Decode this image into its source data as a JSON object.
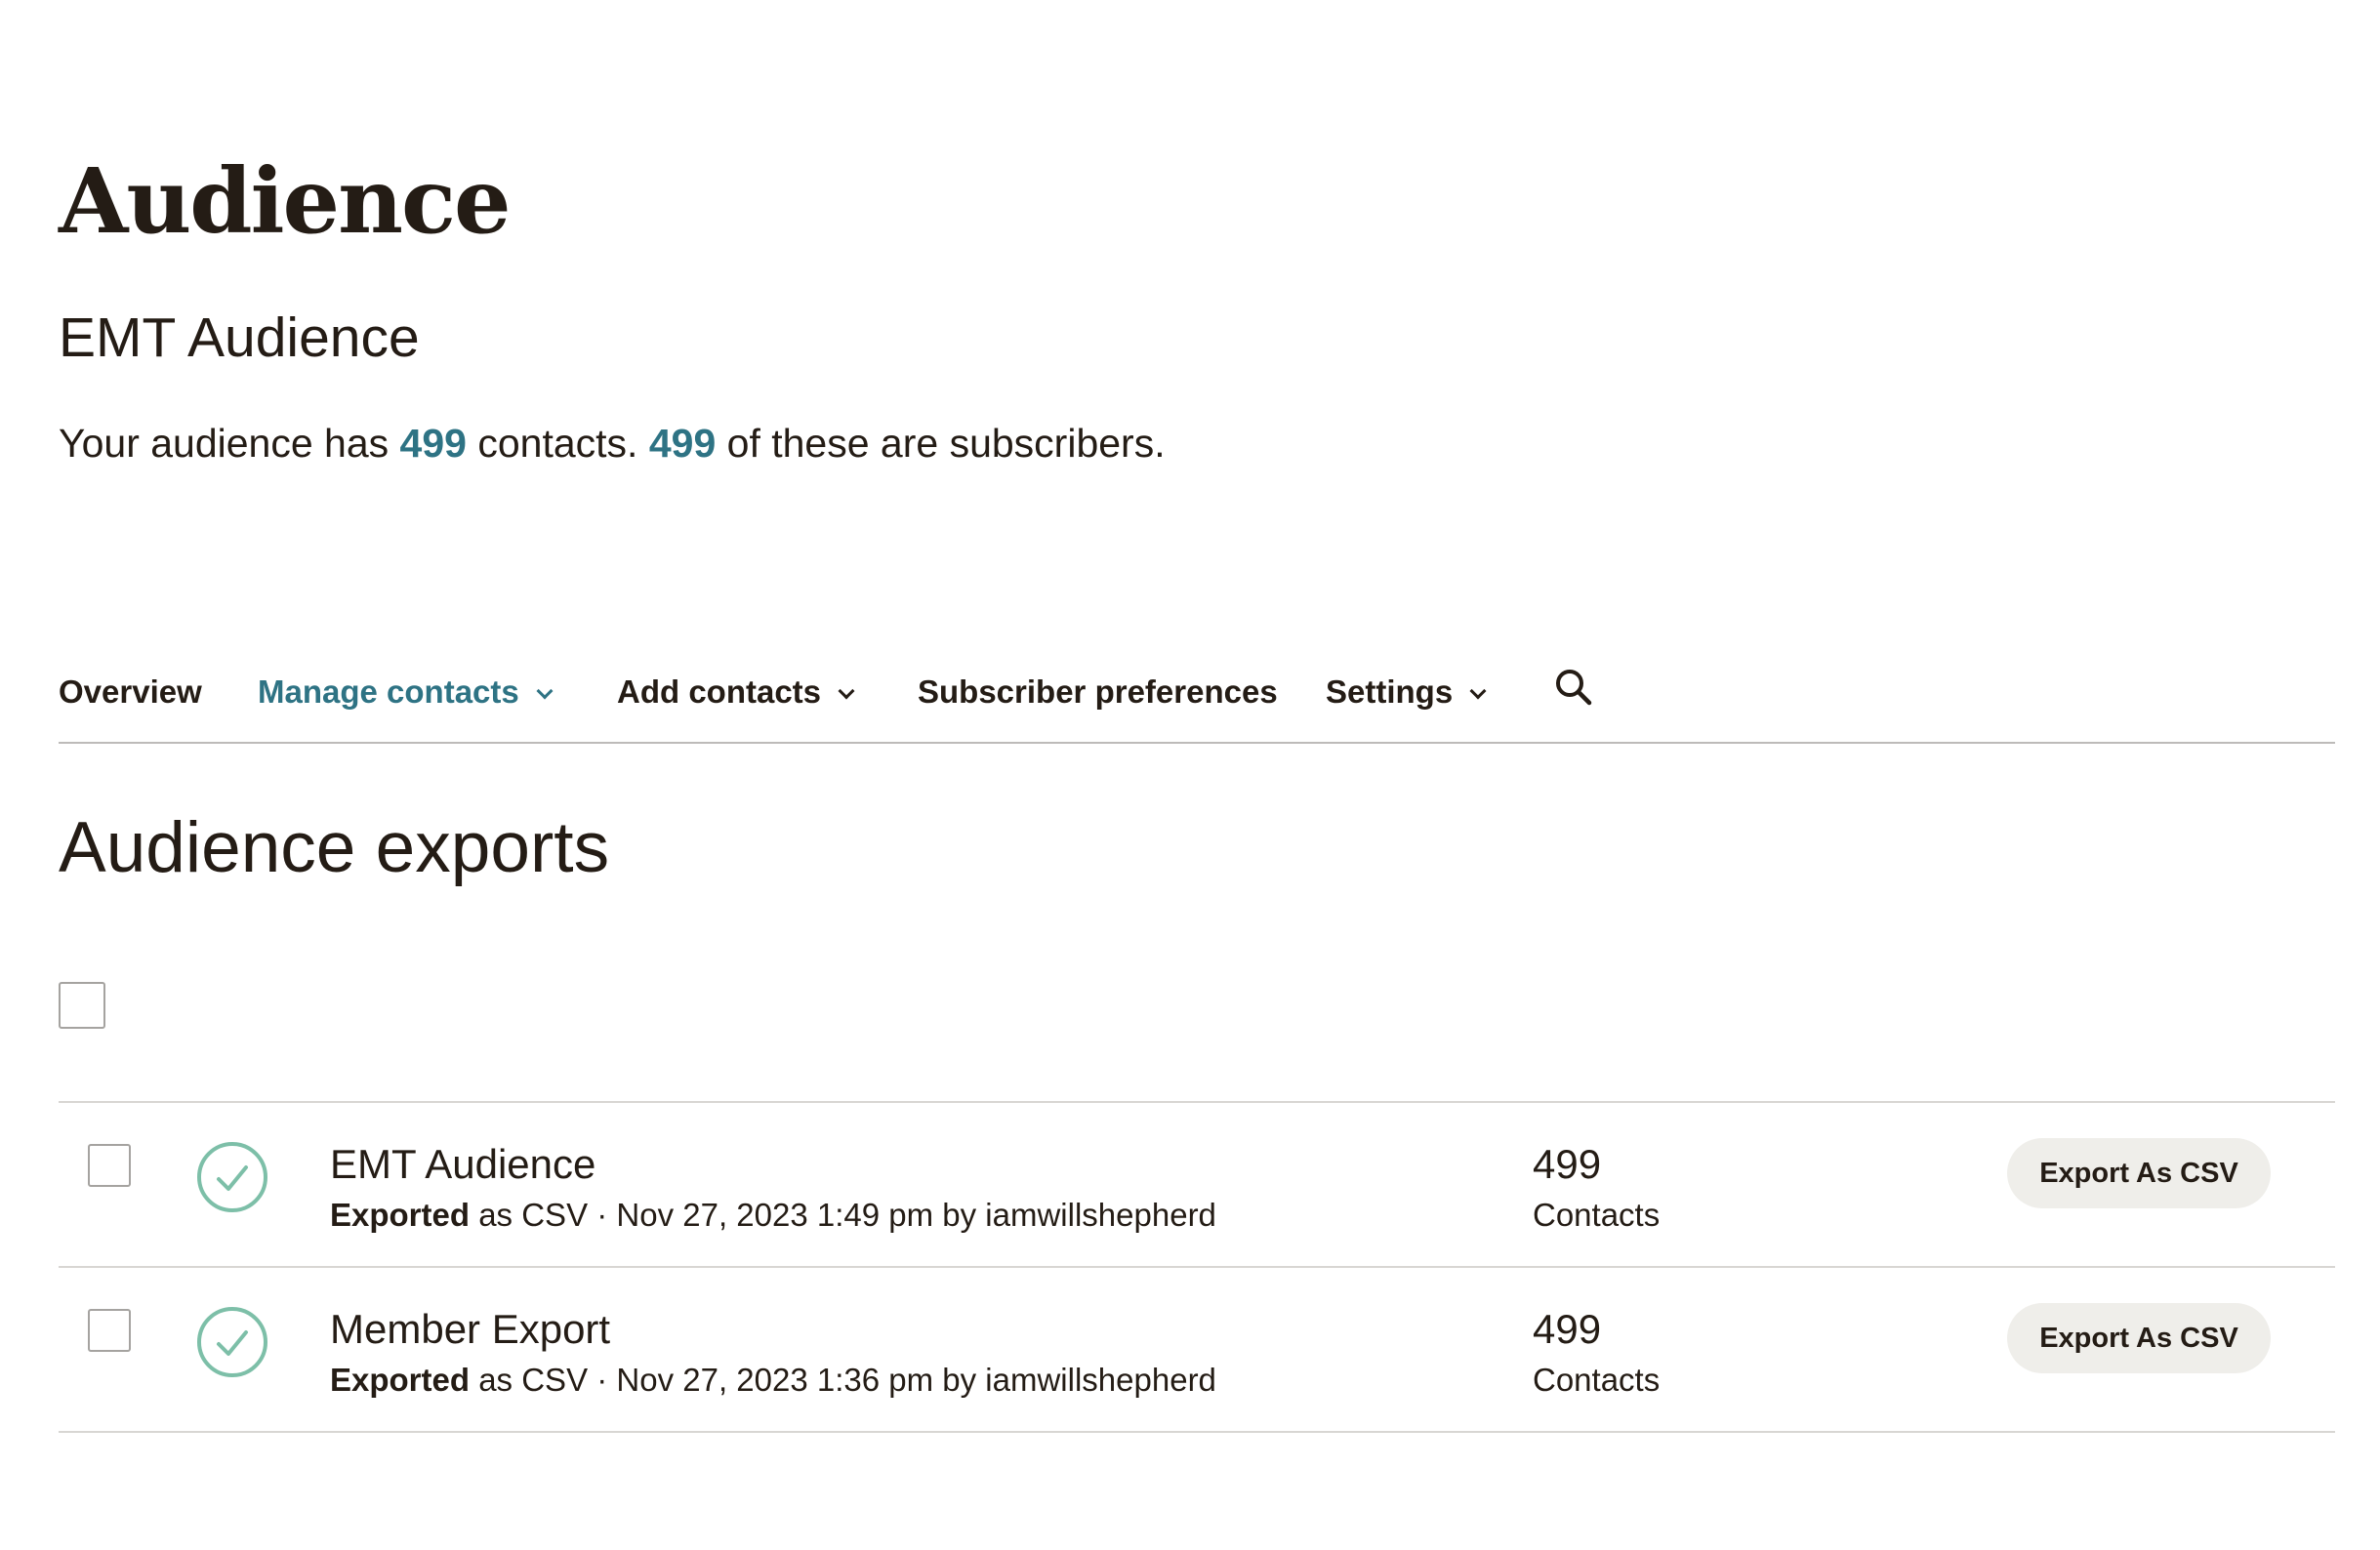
{
  "header": {
    "title": "Audience",
    "audience_name": "EMT Audience",
    "summary": {
      "prefix": "Your audience has ",
      "contacts_count": "499",
      "middle": " contacts. ",
      "subscribers_count": "499",
      "suffix": " of these are subscribers."
    }
  },
  "tabs": [
    {
      "label": "Overview",
      "dropdown": false,
      "active": false
    },
    {
      "label": "Manage contacts",
      "dropdown": true,
      "active": true
    },
    {
      "label": "Add contacts",
      "dropdown": true,
      "active": false
    },
    {
      "label": "Subscriber preferences",
      "dropdown": false,
      "active": false
    },
    {
      "label": "Settings",
      "dropdown": true,
      "active": false
    }
  ],
  "search": {
    "icon": "search-icon"
  },
  "section": {
    "title": "Audience exports"
  },
  "exports": [
    {
      "name": "EMT Audience",
      "status_label": "Exported",
      "details": " as CSV · Nov 27, 2023 1:49 pm by iamwillshepherd",
      "count": "499",
      "count_label": "Contacts",
      "action_label": "Export As CSV",
      "status_icon": "check-circle-icon"
    },
    {
      "name": "Member Export",
      "status_label": "Exported",
      "details": " as CSV · Nov 27, 2023 1:36 pm by iamwillshepherd",
      "count": "499",
      "count_label": "Contacts",
      "action_label": "Export As CSV",
      "status_icon": "check-circle-icon"
    }
  ],
  "colors": {
    "text": "#241c15",
    "accent": "#2e7384",
    "success": "#7dbfa8",
    "button_bg": "#efeeea",
    "divider": "#d8d6d3"
  }
}
